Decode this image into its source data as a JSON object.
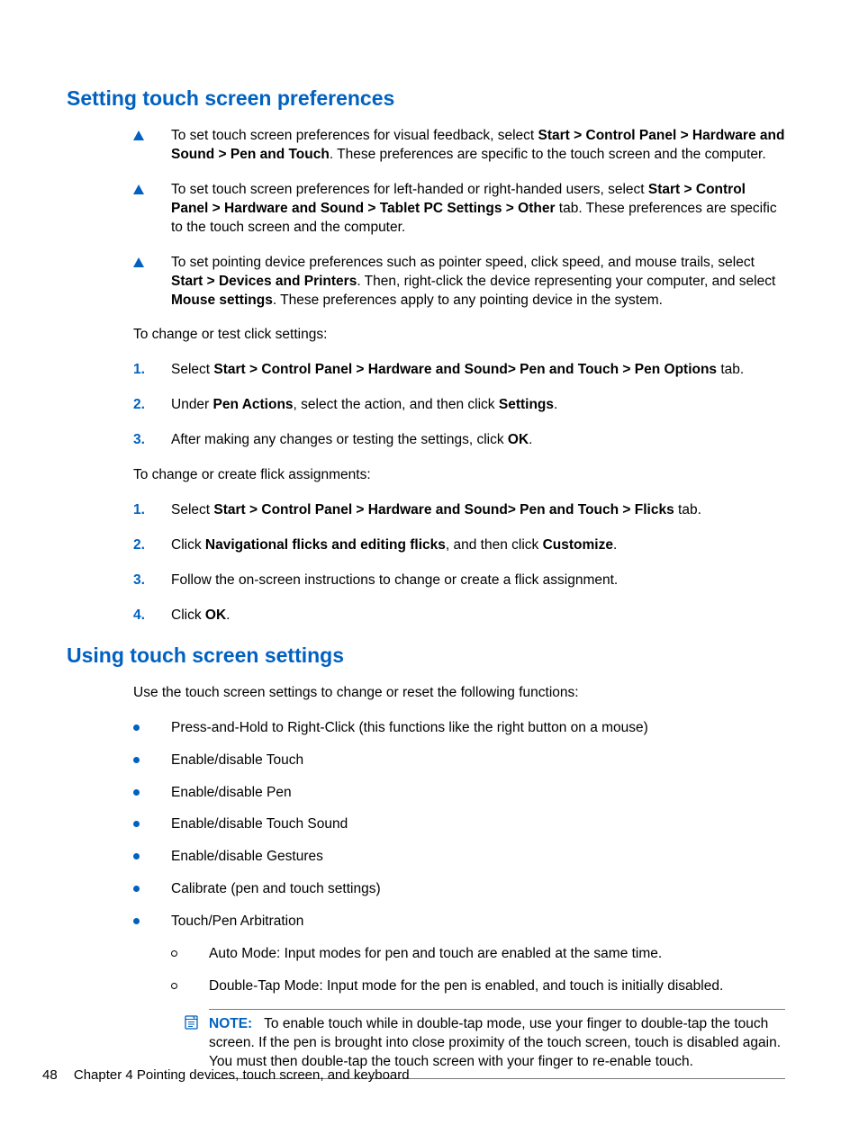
{
  "heading1": "Setting touch screen preferences",
  "tri1_pre": "To set touch screen preferences for visual feedback, select ",
  "tri1_bold": "Start > Control Panel > Hardware and Sound > Pen and Touch",
  "tri1_post": ". These preferences are specific to the touch screen and the computer.",
  "tri2_pre": "To set touch screen preferences for left-handed or right-handed users, select ",
  "tri2_bold": "Start > Control Panel > Hardware and Sound > Tablet PC Settings > Other",
  "tri2_post": " tab. These preferences are specific to the touch screen and the computer.",
  "tri3_pre": "To set pointing device preferences such as pointer speed, click speed, and mouse trails, select ",
  "tri3_bold1": "Start > Devices and Printers",
  "tri3_mid": ". Then, right-click the device representing your computer, and select ",
  "tri3_bold2": "Mouse settings",
  "tri3_post": ". These preferences apply to any pointing device in the system.",
  "para1": "To change or test click settings:",
  "ol1_1_num": "1.",
  "ol1_1_pre": "Select ",
  "ol1_1_bold": "Start > Control Panel > Hardware and Sound> Pen and Touch > Pen Options",
  "ol1_1_post": " tab.",
  "ol1_2_num": "2.",
  "ol1_2_pre": "Under ",
  "ol1_2_bold1": "Pen Actions",
  "ol1_2_mid": ", select the action, and then click ",
  "ol1_2_bold2": "Settings",
  "ol1_2_post": ".",
  "ol1_3_num": "3.",
  "ol1_3_pre": "After making any changes or testing the settings, click ",
  "ol1_3_bold": "OK",
  "ol1_3_post": ".",
  "para2": "To change or create flick assignments:",
  "ol2_1_num": "1.",
  "ol2_1_pre": "Select ",
  "ol2_1_bold": "Start > Control Panel > Hardware and Sound> Pen and Touch > Flicks",
  "ol2_1_post": " tab.",
  "ol2_2_num": "2.",
  "ol2_2_pre": "Click ",
  "ol2_2_bold1": "Navigational flicks and editing flicks",
  "ol2_2_mid": ", and then click ",
  "ol2_2_bold2": "Customize",
  "ol2_2_post": ".",
  "ol2_3_num": "3.",
  "ol2_3_text": "Follow the on-screen instructions to change or create a flick assignment.",
  "ol2_4_num": "4.",
  "ol2_4_pre": "Click ",
  "ol2_4_bold": "OK",
  "ol2_4_post": ".",
  "heading2": "Using touch screen settings",
  "para3": "Use the touch screen settings to change or reset the following functions:",
  "dot1": "Press-and-Hold to Right-Click (this functions like the right button on a mouse)",
  "dot2": "Enable/disable Touch",
  "dot3": "Enable/disable Pen",
  "dot4": "Enable/disable Touch Sound",
  "dot5": "Enable/disable Gestures",
  "dot6": "Calibrate (pen and touch settings)",
  "dot7": "Touch/Pen Arbitration",
  "sub1": "Auto Mode: Input modes for pen and touch are enabled at the same time.",
  "sub2": "Double-Tap Mode: Input mode for the pen is enabled, and touch is initially disabled.",
  "note_label": "NOTE:",
  "note_text": "To enable touch while in double-tap mode, use your finger to double-tap the touch screen. If the pen is brought into close proximity of the touch screen, touch is disabled again. You must then double-tap the touch screen with your finger to re-enable touch.",
  "footer_page": "48",
  "footer_chapter": "Chapter 4   Pointing devices, touch screen, and keyboard"
}
